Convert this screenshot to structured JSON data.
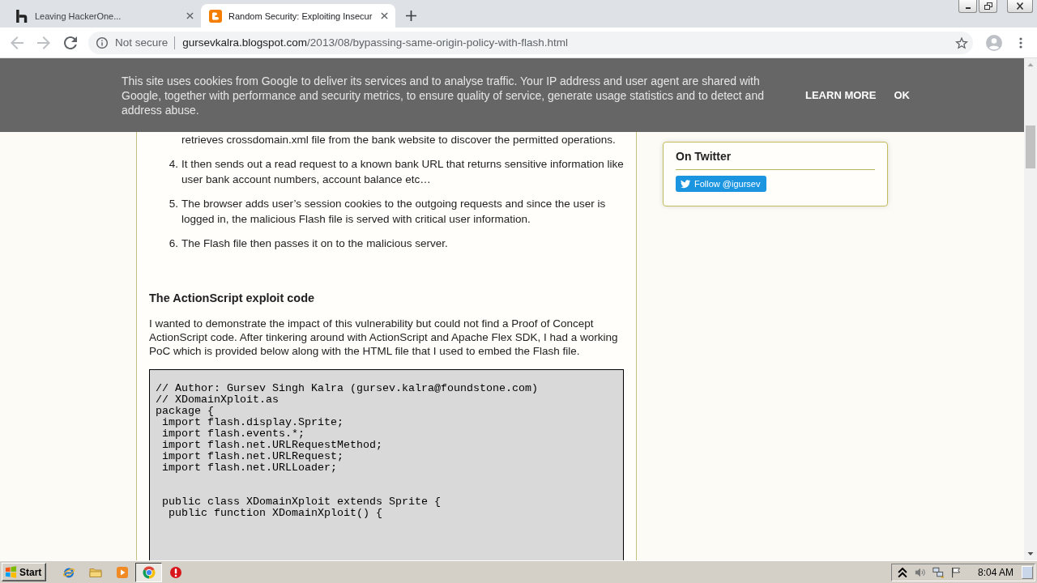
{
  "browser": {
    "tabs": [
      {
        "kind": "hackerone",
        "title": "Leaving HackerOne...",
        "selected": false
      },
      {
        "kind": "blogger",
        "title": "Random Security: Exploiting Insecur",
        "selected": true
      }
    ],
    "nav_buttons": [
      {
        "kind": "back",
        "disabled": true
      },
      {
        "kind": "forward",
        "disabled": true
      },
      {
        "kind": "reload",
        "disabled": false
      }
    ],
    "address_bar": {
      "security_label": "Not secure",
      "host": "gursevkalra.blogspot.com",
      "path": "/2013/08/bypassing-same-origin-policy-with-flash.html"
    }
  },
  "cookie_notice": {
    "text": "This site uses cookies from Google to deliver its services and to analyse traffic. Your IP address and user agent are shared with Google, together with performance and security metrics, to ensure quality of service, generate usage statistics and to detect and address abuse.",
    "actions": [
      "LEARN MORE",
      "OK"
    ]
  },
  "article": {
    "list_items": [
      {
        "text": "retrieves crossdomain.xml file from the bank website to discover the permitted operations."
      },
      {
        "number": "4.",
        "text": "It then sends out a read request to a known bank URL that returns sensitive information like user bank account numbers, account balance etc…"
      },
      {
        "number": "5.",
        "text": "The browser adds user’s session cookies to the outgoing requests and since the user is logged in, the malicious Flash file is served with critical user information."
      },
      {
        "number": "6.",
        "text": "The Flash file then passes it on to the malicious server."
      }
    ],
    "heading": "The ActionScript exploit code",
    "paragraph": "I wanted to demonstrate the impact of this vulnerability but could not find a Proof of Concept ActionScript code. After tinkering around with ActionScript and Apache Flex SDK, I had a working PoC which is provided below along with the HTML file that I used to embed the Flash file.",
    "code": "// Author: Gursev Singh Kalra (gursev.kalra@foundstone.com)\n// XDomainXploit.as\npackage {\n import flash.display.Sprite;\n import flash.events.*;\n import flash.net.URLRequestMethod;\n import flash.net.URLRequest;\n import flash.net.URLLoader;\n\n\n public class XDomainXploit extends Sprite {\n  public function XDomainXploit() {"
  },
  "sidebar": {
    "widget_title": "On Twitter",
    "follow_button": "Follow @igursev"
  },
  "taskbar": {
    "start_label": "Start",
    "apps": [
      {
        "kind": "ie",
        "selected": false
      },
      {
        "kind": "explorer",
        "selected": false
      },
      {
        "kind": "media",
        "selected": false
      },
      {
        "kind": "chrome",
        "selected": true
      },
      {
        "kind": "alert",
        "selected": false
      }
    ],
    "clock": "8:04 AM"
  }
}
